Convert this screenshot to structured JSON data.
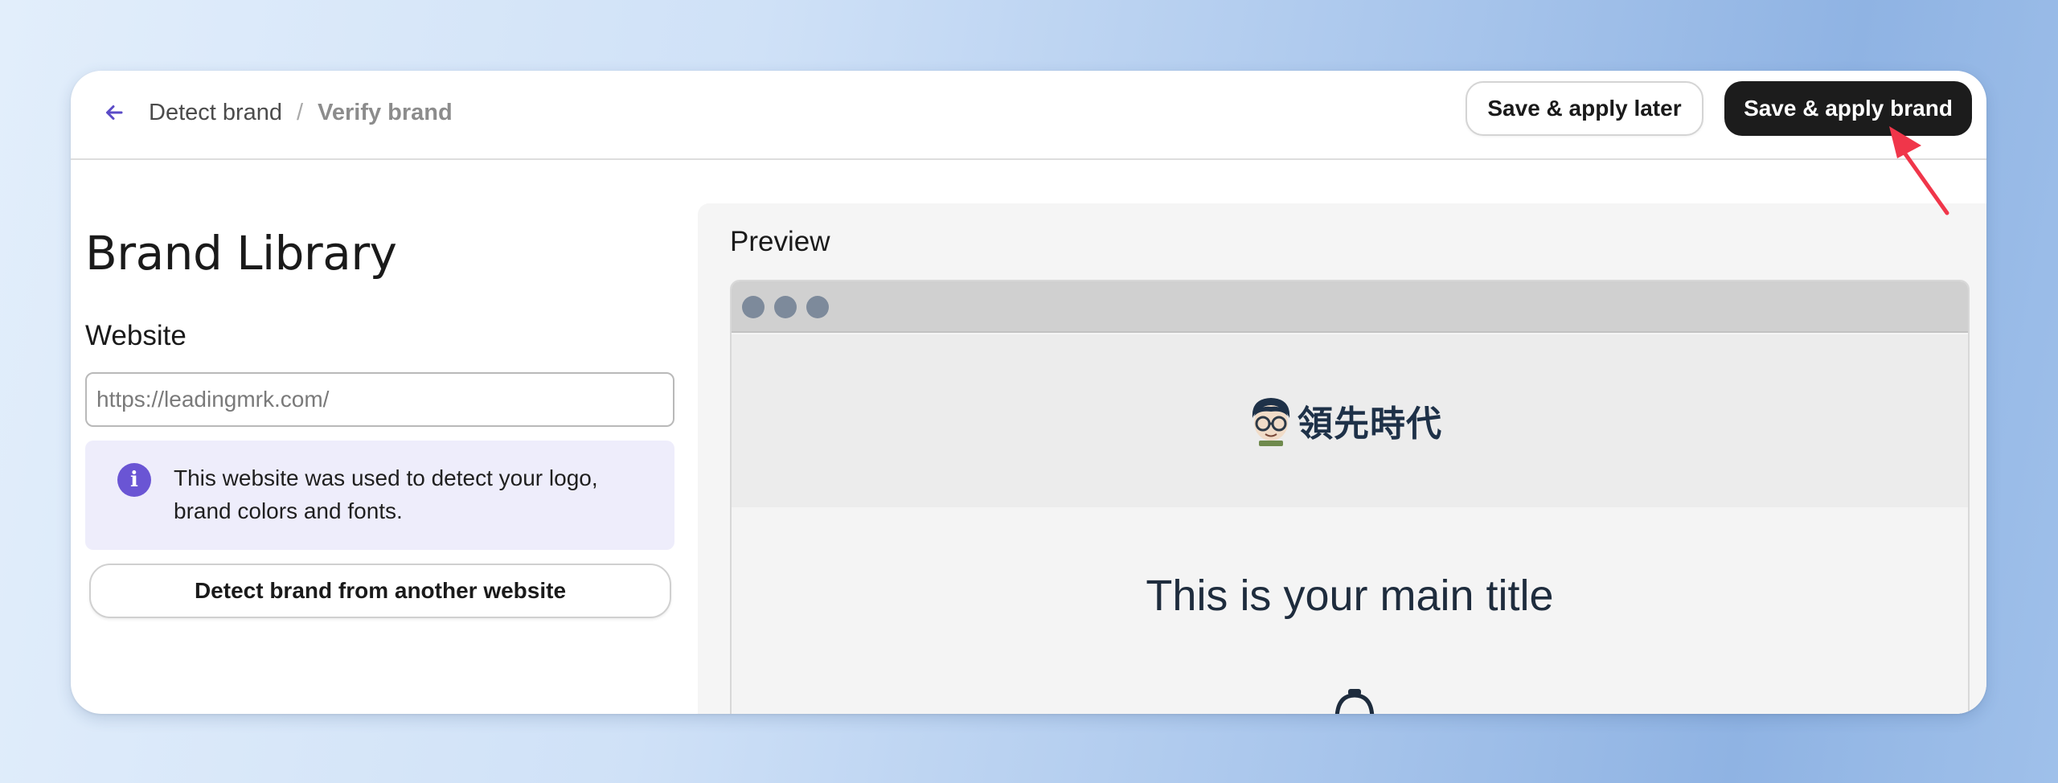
{
  "header": {
    "back_icon": "arrow-left-icon",
    "breadcrumb": {
      "step1": "Detect brand",
      "separator": "/",
      "step2": "Verify brand"
    },
    "save_later_label": "Save & apply later",
    "save_apply_label": "Save & apply brand"
  },
  "left": {
    "title": "Brand Library",
    "website_label": "Website",
    "website_placeholder": "https://leadingmrk.com/",
    "info_icon": "info-icon",
    "info_text": "This website was used to detect your logo, brand colors and fonts.",
    "detect_button_label": "Detect brand from another website"
  },
  "preview": {
    "title": "Preview",
    "logo_text": "領先時代",
    "main_title": "This is your main title"
  },
  "colors": {
    "primary_button": "#1c1c1c",
    "accent": "#6a55d4",
    "info_bg": "#eeedfb",
    "annotation_arrow": "#f0364a"
  }
}
